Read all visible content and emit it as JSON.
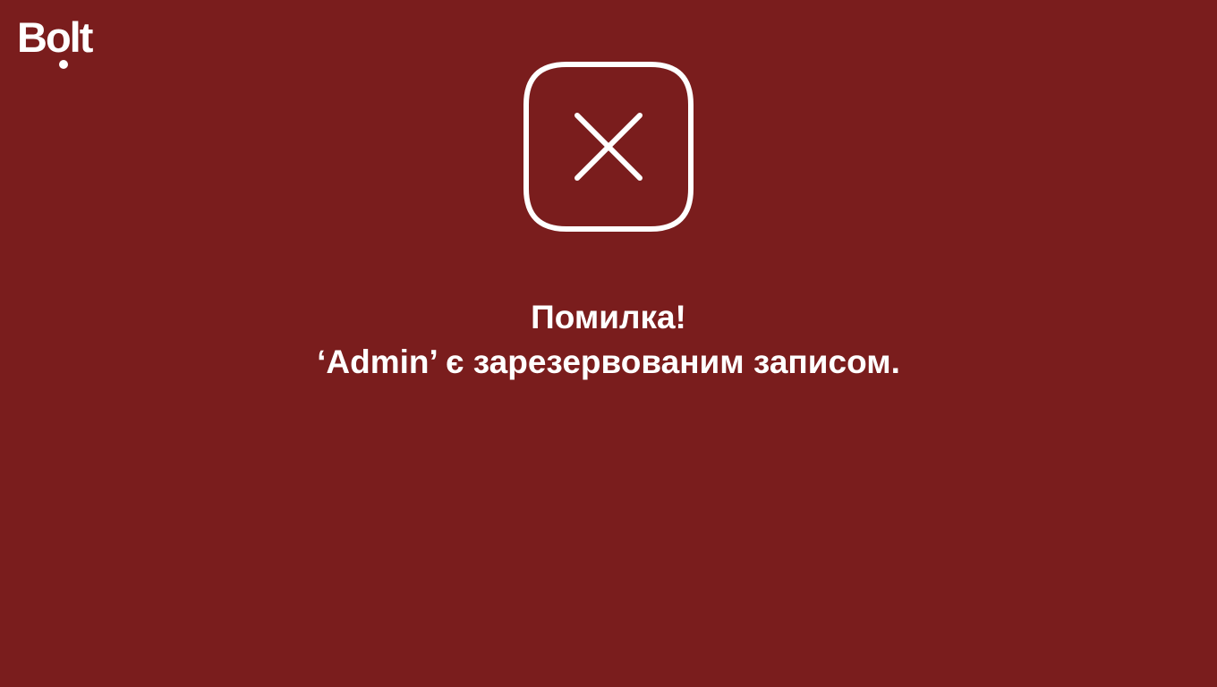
{
  "brand": {
    "logo_text": "Bolt"
  },
  "icon": {
    "name": "close-square-icon"
  },
  "message": {
    "title": "Помилка!",
    "detail": "‘Admin’ є зарезервованим записом."
  },
  "colors": {
    "background": "#7a1d1d",
    "foreground": "#ffffff"
  }
}
